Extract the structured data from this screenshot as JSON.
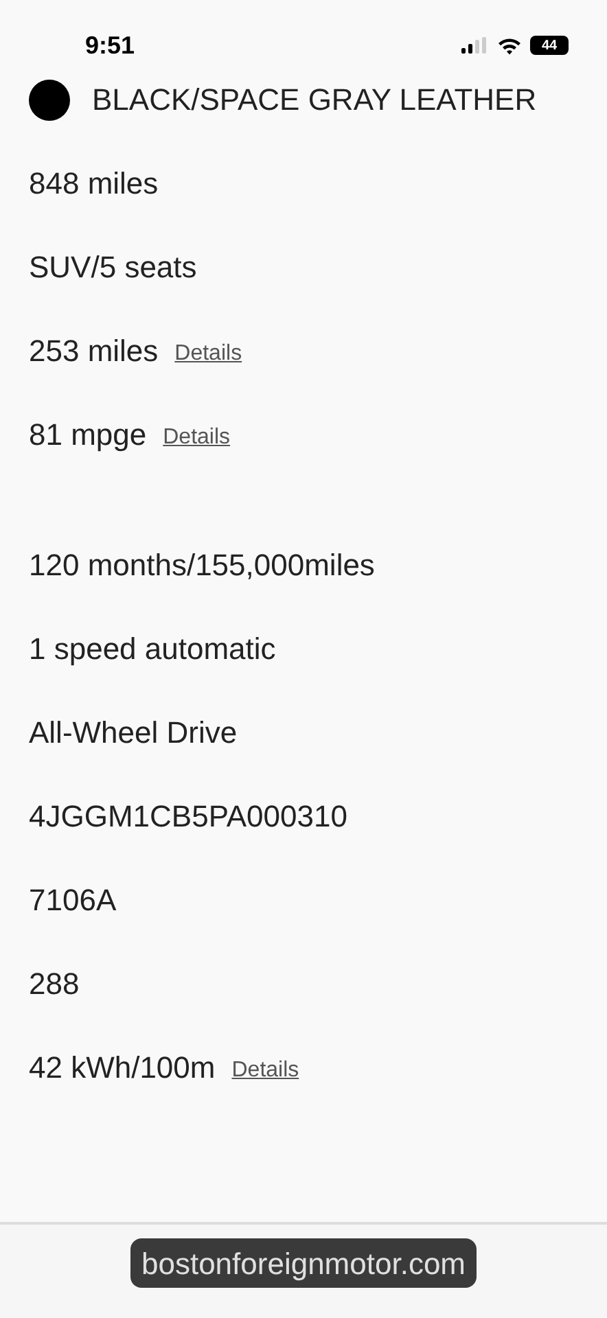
{
  "status_bar": {
    "time": "9:51",
    "battery": "44"
  },
  "sections": [
    {
      "rows": [
        {
          "kind": "swatch",
          "value": "BLACK/SPACE GRAY LEATHER",
          "color": "#000000"
        },
        {
          "kind": "text",
          "value": "848 miles"
        },
        {
          "kind": "text",
          "value": "SUV/5 seats"
        },
        {
          "kind": "link",
          "value": "253 miles",
          "link": "Details"
        },
        {
          "kind": "link",
          "value": "81 mpge",
          "link": "Details"
        }
      ]
    },
    {
      "rows": [
        {
          "kind": "text",
          "value": "120 months/155,000miles"
        },
        {
          "kind": "text",
          "value": "1 speed automatic"
        },
        {
          "kind": "text",
          "value": "All-Wheel Drive"
        },
        {
          "kind": "text",
          "value": "4JGGM1CB5PA000310"
        },
        {
          "kind": "text",
          "value": "7106A"
        },
        {
          "kind": "text",
          "value": "288"
        },
        {
          "kind": "link",
          "value": "42 kWh/100m",
          "link": "Details"
        }
      ]
    }
  ],
  "address_bar": {
    "url": "bostonforeignmotor.com"
  }
}
